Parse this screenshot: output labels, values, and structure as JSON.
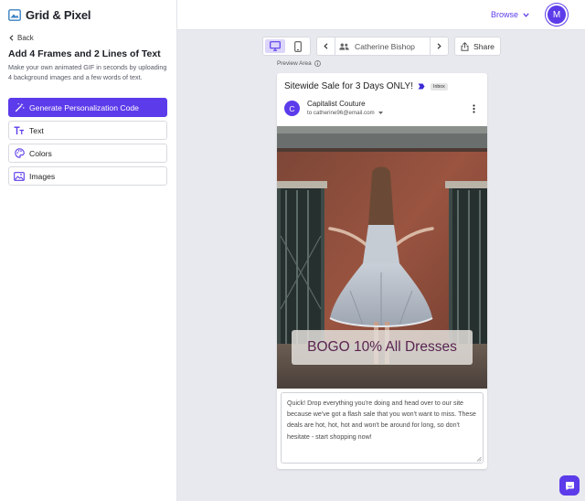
{
  "logo": {
    "text": "Grid & Pixel"
  },
  "sidebar": {
    "back_label": "Back",
    "heading": "Add 4 Frames and 2 Lines of Text",
    "description": "Make your own animated GIF in seconds by uploading 4 background images and a few words of text.",
    "buttons": [
      {
        "label": "Generate Personalization Code",
        "icon": "magic-wand-icon"
      },
      {
        "label": "Text",
        "icon": "text-format-icon"
      },
      {
        "label": "Colors",
        "icon": "palette-icon"
      },
      {
        "label": "Images",
        "icon": "image-icon"
      }
    ]
  },
  "topbar": {
    "browse_label": "Browse",
    "avatar_initial": "M"
  },
  "toolbar": {
    "persona_name": "Catherine Bishop",
    "share_label": "Share",
    "preview_label": "Preview Area"
  },
  "email": {
    "subject": "Sitewide Sale for 3 Days ONLY!",
    "badge": "Inbox",
    "sender_initial": "C",
    "sender_name": "Capitalist Couture",
    "recipient": "to catherine96@email.com",
    "overlay_text": "BOGO 10% All Dresses",
    "body_text": "Quick! Drop everything you're doing and head over to our site because we've got a flash sale that you won't want to miss. These deals are hot, hot, hot and won't be around for long, so don't hesitate - start shopping now!"
  },
  "colors": {
    "accent": "#5b3bea",
    "overlay_text": "#5a2450"
  }
}
